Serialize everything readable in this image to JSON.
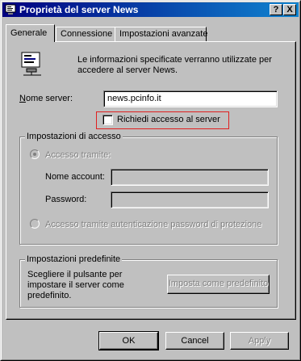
{
  "window": {
    "title": "Proprietà del server News"
  },
  "titlebar_buttons": {
    "help": "?",
    "close": "X"
  },
  "tabs": [
    {
      "label": "Generale",
      "active": true
    },
    {
      "label": "Connessione",
      "active": false
    },
    {
      "label": "Impostazioni avanzate",
      "active": false
    }
  ],
  "general": {
    "intro_text": "Le informazioni specificate verranno utilizzate per accedere al server News.",
    "server_name_label": "Nome server:",
    "server_name_value": "news.pcinfo.it",
    "require_login_label": "Richiedi accesso al server",
    "require_login_checked": false
  },
  "access_settings": {
    "title": "Impostazioni di accesso",
    "access_via_label": "Accesso tramite:",
    "account_name_label": "Nome account:",
    "account_name_value": "",
    "password_label": "Password:",
    "password_value": "",
    "spa_label": "Accesso tramite autenticazione password di protezione"
  },
  "defaults": {
    "title": "Impostazioni predefinite",
    "description": "Scegliere il pulsante per impostare il server come predefinito.",
    "set_default_button": "Imposta come predefinito"
  },
  "footer_buttons": {
    "ok": "OK",
    "cancel": "Cancel",
    "apply": "Apply"
  },
  "colors": {
    "titlebar_start": "#000080",
    "titlebar_end": "#1084d0",
    "highlight": "#e02020"
  }
}
